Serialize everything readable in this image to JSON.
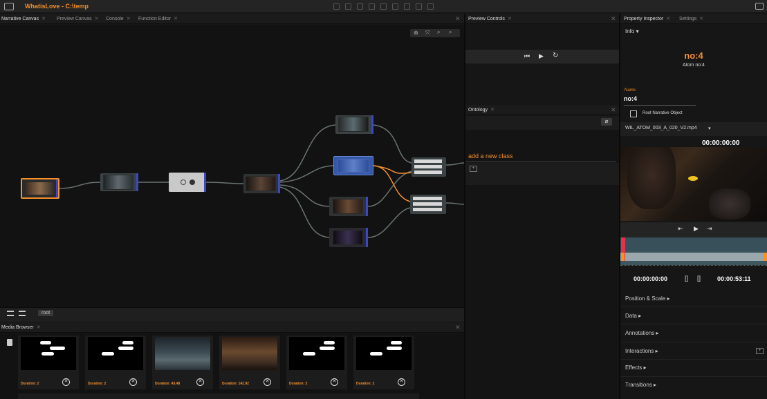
{
  "window": {
    "title": "WhatisLove - C:\\temp"
  },
  "left_tabs": [
    {
      "label": "Narrative Canvas",
      "active": true
    },
    {
      "label": "Preview Canvas"
    },
    {
      "label": "Console"
    },
    {
      "label": "Function Editor"
    }
  ],
  "canvas": {
    "root_label": "root"
  },
  "preview": {
    "tab": "Preview Controls"
  },
  "ontology": {
    "tab": "Ontology",
    "add_class": "add a new class"
  },
  "media": {
    "tab": "Media Browser",
    "items": [
      {
        "duration": "Duration: 2"
      },
      {
        "duration": "Duration: 2"
      },
      {
        "duration": "Duration: 43.48"
      },
      {
        "duration": "Duration: 142.92"
      },
      {
        "duration": "Duration: 2"
      },
      {
        "duration": "Duration: 2"
      }
    ]
  },
  "inspector": {
    "tabs": [
      {
        "label": "Property Inspector",
        "active": true
      },
      {
        "label": "Settings"
      }
    ],
    "info_label": "Info",
    "node_title": "no:4",
    "node_subtitle": "Atom no:4",
    "name_label": "Name",
    "name_value": "no:4",
    "root_checkbox_label": "Root Narrative Object",
    "root_checked": false,
    "media_file": "WIL_ATOM_003_A_020_V2.mp4",
    "timecode_top": "00:00:00:00",
    "time_start": "00:00:00:00",
    "time_end": "00:00:53:11",
    "sections": [
      "Position & Scale",
      "Data",
      "Annotations",
      "Interactions",
      "Effects",
      "Transitions"
    ]
  },
  "colors": {
    "accent": "#f5902b",
    "node_edge": "#3a47c8",
    "scrub_red": "#e8304a"
  }
}
